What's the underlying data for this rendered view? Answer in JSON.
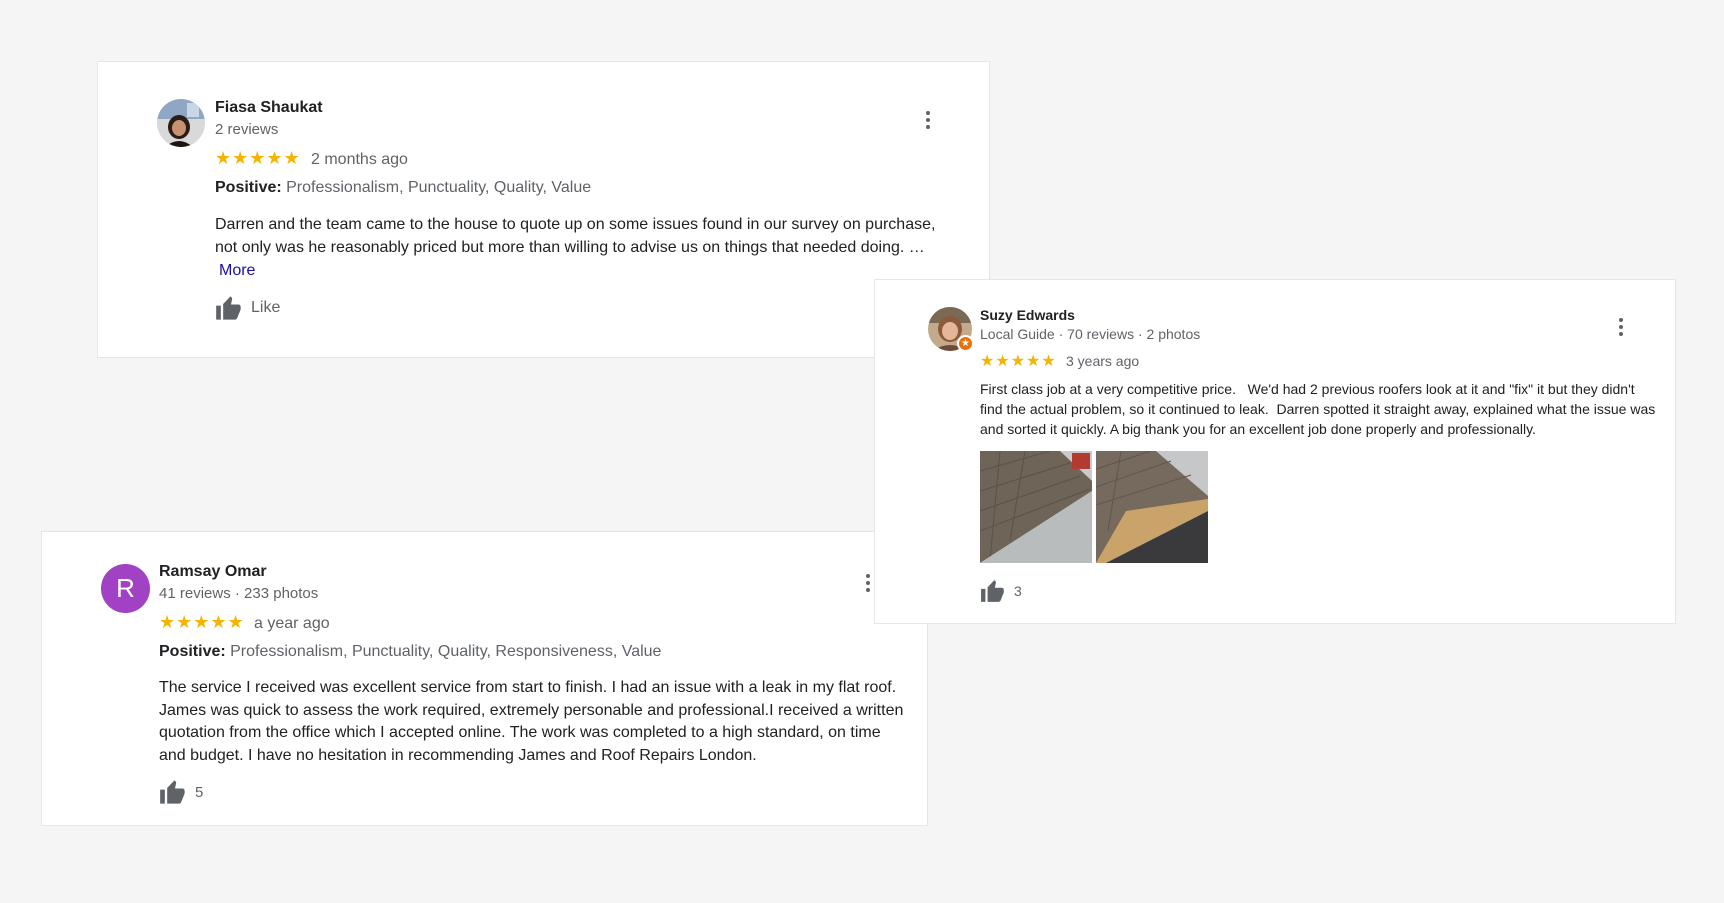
{
  "reviews": [
    {
      "name": "Fiasa Shaukat",
      "meta": "2 reviews",
      "stars": "★★★★★",
      "time": "2 months ago",
      "positive_label": "Positive:",
      "positive_values": " Professionalism, Punctuality, Quality, Value",
      "text": "Darren and the team came to the house to quote up on some issues found in our survey on purchase, not only was he reasonably priced but more than willing to advise us on things that needed doing. …",
      "more_label": "More",
      "like_label": "Like"
    },
    {
      "name": "Ramsay Omar",
      "avatar_letter": "R",
      "meta": "41 reviews · 233 photos",
      "stars": "★★★★★",
      "time": "a year ago",
      "positive_label": "Positive:",
      "positive_values": " Professionalism, Punctuality, Quality, Responsiveness, Value",
      "text": "The service I received was excellent service from start to finish. I had an issue with a leak in my flat roof. James was quick to assess the work required, extremely personable and professional.I received a written quotation from the office which I accepted online. The work was completed to a high standard, on time and budget. I have no hesitation in recommending James and Roof Repairs London.",
      "like_count": "5"
    },
    {
      "name": "Suzy Edwards",
      "meta": "Local Guide · 70 reviews · 2 photos",
      "badge": "★",
      "stars": "★★★★★",
      "time": "3 years ago",
      "text": "First class job at a very competitive price.   We'd had 2 previous roofers look at it and \"fix\" it but they didn't find the actual problem, so it continued to leak.  Darren spotted it straight away, explained what the issue was and sorted it quickly. A big thank you for an excellent job done properly and professionally.",
      "like_count": "3"
    }
  ],
  "colors": {
    "star": "#f4b400",
    "avatar_r": "#a142c4",
    "more_link": "#1a0dab",
    "local_guide_badge": "#e8710a"
  },
  "icons": [
    "kebab-menu-icon",
    "thumbs-up-icon",
    "local-guide-badge-icon"
  ]
}
